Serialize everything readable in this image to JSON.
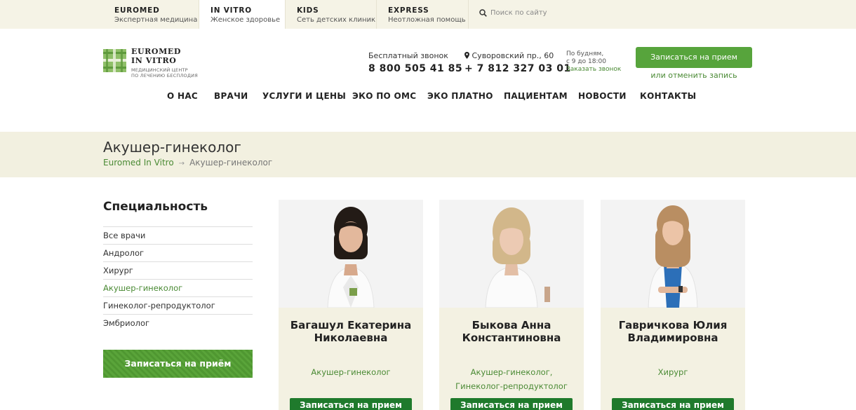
{
  "topbar": {
    "tabs": [
      {
        "title": "EUROMED",
        "subtitle": "Экспертная медицина"
      },
      {
        "title": "IN VITRO",
        "subtitle": "Женское здоровье"
      },
      {
        "title": "KIDS",
        "subtitle": "Сеть детских клиник"
      },
      {
        "title": "EXPRESS",
        "subtitle": "Неотложная помощь"
      }
    ],
    "search_placeholder": "Поиск по сайту"
  },
  "header": {
    "logo": {
      "line1": "EUROMED",
      "line2": "IN VITRO",
      "line3": "МЕДИЦИНСКИЙ ЦЕНТР",
      "line4": "ПО ЛЕЧЕНИЮ БЕСПЛОДИЯ"
    },
    "free_call_label": "Бесплатный звонок",
    "free_call_number": "8 800 505 41 85",
    "address": "Суворовский пр., 60",
    "phone": "+ 7 812 327 03 01",
    "hours_line1": "По будням,",
    "hours_line2": "с 9 до 18:00",
    "order_call": "Заказать звонок",
    "book_button": "Записаться на прием",
    "cancel_link": "или отменить запись"
  },
  "nav": [
    "О НАС",
    "ВРАЧИ",
    "УСЛУГИ И ЦЕНЫ",
    "ЭКО ПО ОМС",
    "ЭКО ПЛАТНО",
    "ПАЦИЕНТАМ",
    "НОВОСТИ",
    "КОНТАКТЫ"
  ],
  "page": {
    "title": "Акушер-гинеколог",
    "breadcrumb": {
      "home": "Euromed In Vitro",
      "separator": "→",
      "current": "Акушер-гинеколог"
    }
  },
  "sidebar": {
    "title": "Специальность",
    "items": [
      "Все врачи",
      "Андролог",
      "Хирург",
      "Акушер-гинеколог",
      "Гинеколог-репродуктолог",
      "Эмбриолог"
    ],
    "active_index": 3,
    "book_button": "Записаться на приём"
  },
  "doctors": [
    {
      "name_line1": "Багашул Екатерина",
      "name_line2": "Николаевна",
      "spec_line1": "Акушер-гинеколог",
      "spec_line2": "",
      "button": "Записаться на прием",
      "hair": "dark"
    },
    {
      "name_line1": "Быкова Анна",
      "name_line2": "Константиновна",
      "spec_line1": "Акушер-гинеколог,",
      "spec_line2": "Гинеколог-репродуктолог",
      "button": "Записаться на прием",
      "hair": "blonde"
    },
    {
      "name_line1": "Гавричкова Юлия",
      "name_line2": "Владимировна",
      "spec_line1": "Хирург",
      "spec_line2": "",
      "button": "Записаться на прием",
      "hair": "light-brown"
    }
  ],
  "colors": {
    "accent_green": "#57a43c",
    "link_green": "#4a8a34",
    "band": "#f2f0e0",
    "topbar": "#f5f3e6"
  }
}
